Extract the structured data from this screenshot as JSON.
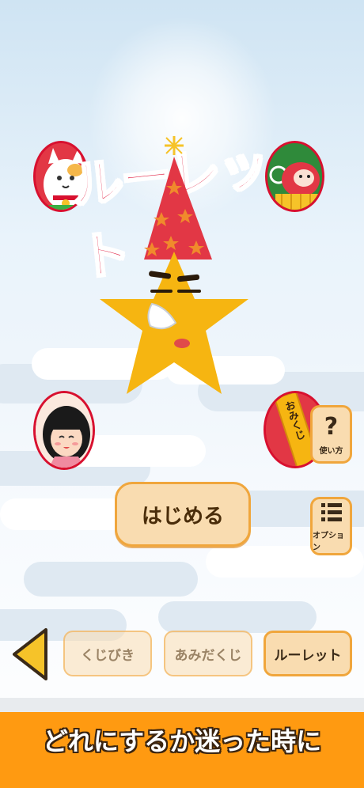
{
  "title": "ルーレット",
  "buttons": {
    "start_label": "はじめる",
    "help_label": "使い方",
    "help_glyph": "?",
    "options_label": "オプション"
  },
  "tabs": [
    {
      "label": "くじびき",
      "active": false
    },
    {
      "label": "あみだくじ",
      "active": false
    },
    {
      "label": "ルーレット",
      "active": true
    }
  ],
  "banner": {
    "text": "どれにするか迷った時に"
  },
  "omikuji_text": "おみくじ",
  "colors": {
    "accent_red": "#e01a3d",
    "button_fill": "#f9dcb0",
    "button_border": "#f0a63c",
    "banner_orange": "#ff9a11",
    "star_yellow": "#f6b511"
  },
  "icons": [
    "back-arrow-icon",
    "question-icon",
    "list-icon",
    "star-character",
    "maneki-neko-icon",
    "daruma-icon",
    "girl-icon",
    "omikuji-icon"
  ]
}
